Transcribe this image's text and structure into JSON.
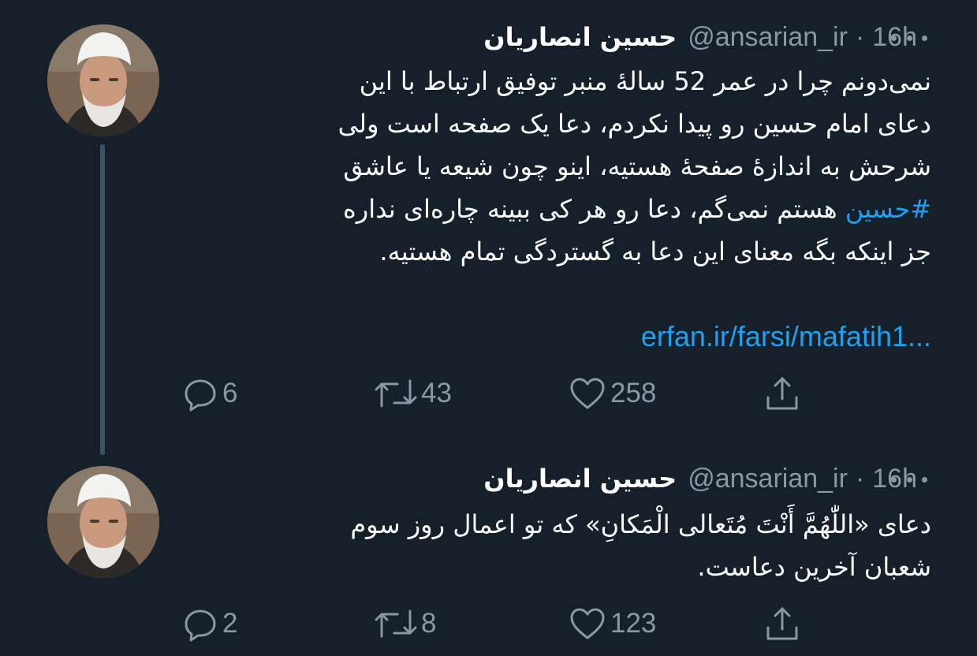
{
  "tweets": [
    {
      "display_name": "حسین انصاریان",
      "handle": "@ansarian_ir",
      "separator": "·",
      "time": "16h",
      "text_lines": [
        "نمی‌دونم چرا در عمر 52 سالهٔ منبر توفیق ارتباط با این",
        "دعای امام حسین رو پیدا نکردم، دعا یک صفحه است ولی",
        "شرحش به اندازهٔ صفحهٔ هستیه، اینو چون شیعه یا عاشق"
      ],
      "hashtag": "#حسین",
      "line4_rest": " هستم نمی‌گم، دعا رو هر کی ببینه چاره‌ای نداره",
      "line5": "جز اینکه بگه معنای این دعا به گستردگی تمام هستیه.",
      "link": "erfan.ir/farsi/mafatih1...",
      "replies": "6",
      "retweets": "43",
      "likes": "258"
    },
    {
      "display_name": "حسین انصاریان",
      "handle": "@ansarian_ir",
      "separator": "·",
      "time": "16h",
      "text_lines": [
        "دعای «اللّٰهُمَّ أَنْتَ مُتَعالی الْمَکانِ» که تو اعمال روز سوم",
        "شعبان آخرین دعاست."
      ],
      "replies": "2",
      "retweets": "8",
      "likes": "123"
    }
  ],
  "icons": {
    "reply": "reply-icon",
    "retweet": "retweet-icon",
    "like": "heart-icon",
    "share": "share-icon",
    "more": "more-icon"
  },
  "colors": {
    "background": "#15202b",
    "text": "#ffffff",
    "secondary": "#8899a6",
    "accent": "#1da1f2"
  }
}
